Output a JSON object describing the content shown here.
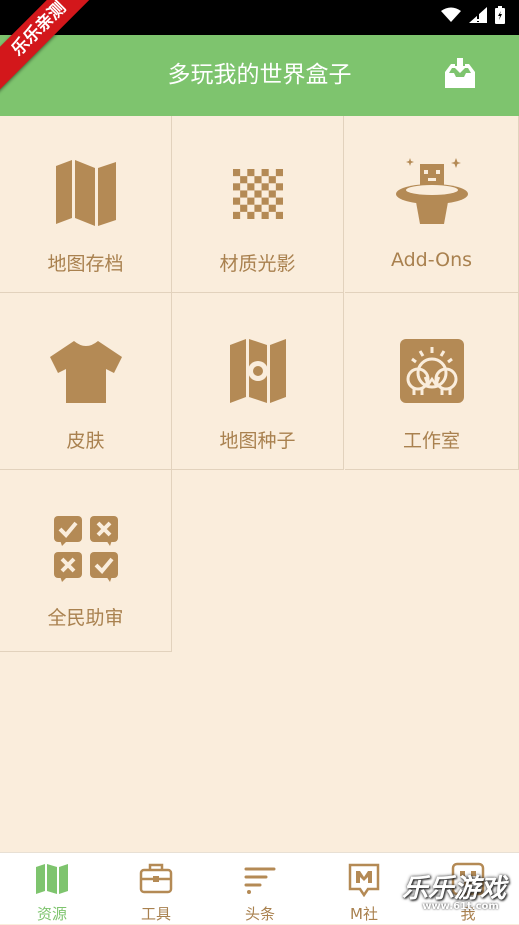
{
  "ribbon": {
    "text": "乐乐亲测"
  },
  "appbar": {
    "title": "多玩我的世界盒子",
    "download_icon": "download-tray-icon"
  },
  "grid": {
    "items": [
      {
        "label": "地图存档",
        "icon": "map-icon"
      },
      {
        "label": "材质光影",
        "icon": "checker-texture-icon"
      },
      {
        "label": "Add-Ons",
        "icon": "magic-hat-icon"
      },
      {
        "label": "皮肤",
        "icon": "shirt-icon"
      },
      {
        "label": "地图种子",
        "icon": "map-seed-icon"
      },
      {
        "label": "工作室",
        "icon": "studio-icon"
      },
      {
        "label": "全民助审",
        "icon": "review-icon"
      }
    ]
  },
  "tabs": [
    {
      "label": "资源",
      "icon": "map-icon",
      "active": true
    },
    {
      "label": "工具",
      "icon": "toolbox-icon",
      "active": false
    },
    {
      "label": "头条",
      "icon": "headlines-icon",
      "active": false
    },
    {
      "label": "M社",
      "icon": "m-community-icon",
      "active": false
    },
    {
      "label": "我",
      "icon": "profile-icon",
      "active": false
    }
  ],
  "watermark": {
    "title": "乐乐游戏",
    "url": "www.61t.com"
  },
  "colors": {
    "accent": "#7ec46e",
    "icon": "#a9814f",
    "background": "#faeddc"
  }
}
